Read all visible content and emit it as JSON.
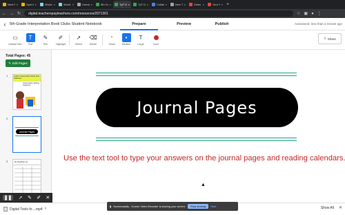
{
  "browser": {
    "tabs": [
      {
        "label": "Next Ro",
        "color": "#f4b400",
        "active": false
      },
      {
        "label": "Spot th",
        "color": "#f4b400",
        "active": false
      },
      {
        "label": "World V",
        "color": "#7dd3fc",
        "active": false
      },
      {
        "label": "World V",
        "color": "#7dd3fc",
        "active": false
      },
      {
        "label": "Homepi",
        "color": "#aaaaaa",
        "active": false
      },
      {
        "label": "5th Gr",
        "color": "#34a853",
        "active": false
      },
      {
        "label": "TpT Di",
        "color": "#34a853",
        "active": true
      },
      {
        "label": "TpT Dig",
        "color": "#34a853",
        "active": false
      },
      {
        "label": "Collabo",
        "color": "#4285f4",
        "active": false
      },
      {
        "label": "New Tab",
        "color": "#9aa0a6",
        "active": false
      },
      {
        "label": "Video",
        "color": "#ea4335",
        "active": false
      },
      {
        "label": "Your S",
        "color": "#ea4335",
        "active": false
      }
    ],
    "url": "digital.teacherspayteachers.com/resources/2971301"
  },
  "app": {
    "doc_title": "5th Grade Interpretation Book Clubs Student Notebook",
    "modes": [
      "Prepare",
      "Preview",
      "Publish"
    ],
    "autosave": "Autosaved: less than a minute ago"
  },
  "toolbar": {
    "tools": [
      "Answer Box",
      "Text",
      "Pen",
      "Highlight",
      "Select",
      "Delete"
    ],
    "sizes": [
      "Small",
      "Medium",
      "Large"
    ],
    "color_label": "Color",
    "text_color": "#c62828",
    "share_label": "Share"
  },
  "sidebar": {
    "total_pages": "Total Pages: 45",
    "edit_pages": "Edit Pages",
    "page_numbers": [
      "1",
      "2",
      "3"
    ],
    "thumb1_title": "Letter's Interpretation Book Club Notebook",
    "thumb1_sub": "Interpretation Writing Notebook",
    "thumb2_title": "Journal Pages",
    "thumb3_title": "My Reading Log"
  },
  "page": {
    "title": "Journal Pages",
    "instruction": "Use the text tool to type your answers on the journal pages and reading calendars.",
    "rule_color": "#29a38b"
  },
  "notice": {
    "text": "Screencastify - Screen Video Recorder is sharing your screen.",
    "stop": "Stop sharing",
    "hide": "Hide"
  },
  "downloads": {
    "file": "Digital Tools fo....mp4",
    "show_all": "Show All"
  }
}
